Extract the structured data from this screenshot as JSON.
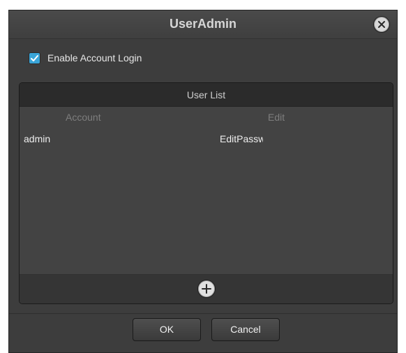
{
  "dialog": {
    "title": "UserAdmin",
    "close_icon": "close-icon"
  },
  "enable_login": {
    "label": "Enable Account Login",
    "checked": true
  },
  "user_list": {
    "title": "User List",
    "columns": [
      "Account",
      "Edit"
    ],
    "rows": [
      {
        "account": "admin",
        "edit": "EditPassw"
      }
    ],
    "add_icon": "plus-icon"
  },
  "buttons": {
    "ok": "OK",
    "cancel": "Cancel"
  },
  "colors": {
    "checkbox_accent": "#3aa5d8",
    "dialog_bg": "#3d3d3d"
  }
}
